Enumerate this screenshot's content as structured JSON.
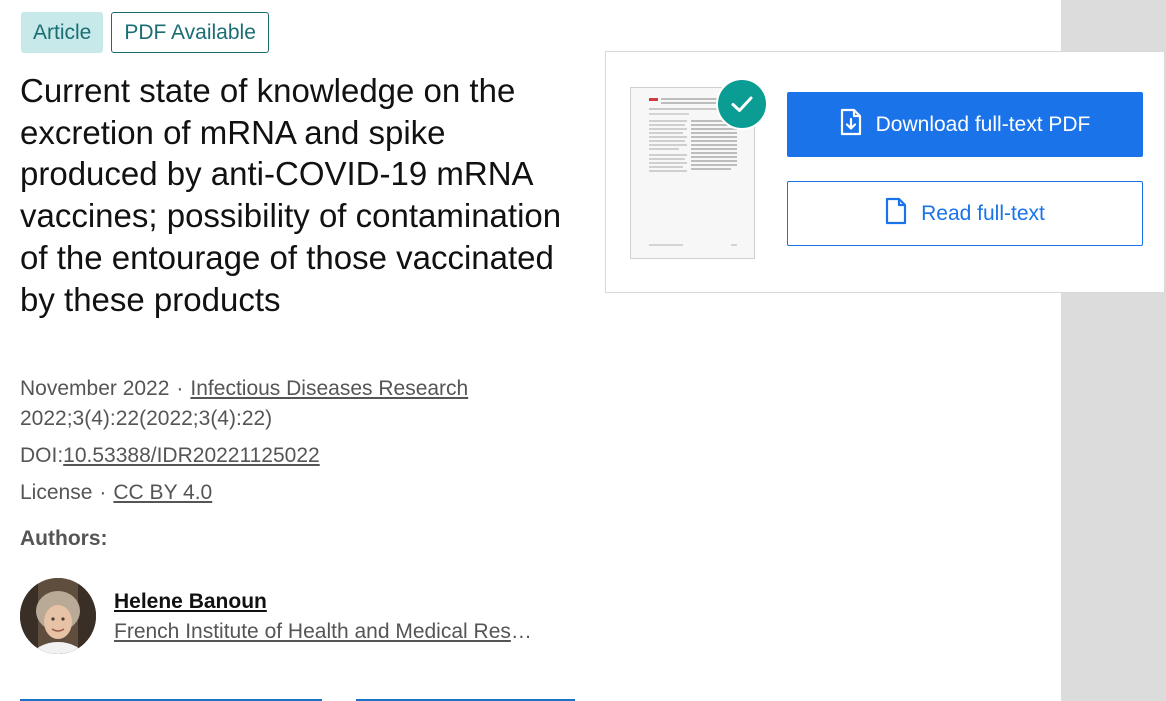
{
  "badges": {
    "article": "Article",
    "pdf": "PDF Available"
  },
  "title": "Current state of knowledge on the excretion of mRNA and spike produced by anti-COVID-19 mRNA vaccines; possibility of contamination of the entourage of those vaccinated by these products",
  "meta": {
    "date": "November 2022",
    "separator": "·",
    "journal": "Infectious Diseases Research",
    "citation": "2022;3(4):22(2022;3(4):22)",
    "doi_label": "DOI:",
    "doi": "10.53388/IDR20221125022",
    "license_label": "License",
    "license": "CC BY 4.0"
  },
  "authors_label": "Authors:",
  "authors": [
    {
      "name": "Helene Banoun",
      "institution": "French Institute of Health and Medical Research"
    }
  ],
  "actions": {
    "download_label": "Download full-text PDF",
    "read_label": "Read full-text"
  },
  "colors": {
    "accent": "#1a73e8",
    "teal": "#0b9c94",
    "badge_bg": "#c8e9e9",
    "badge_text": "#1a6e73"
  },
  "icons": {
    "download": "file-download-icon",
    "read": "file-icon",
    "check": "check-icon"
  }
}
